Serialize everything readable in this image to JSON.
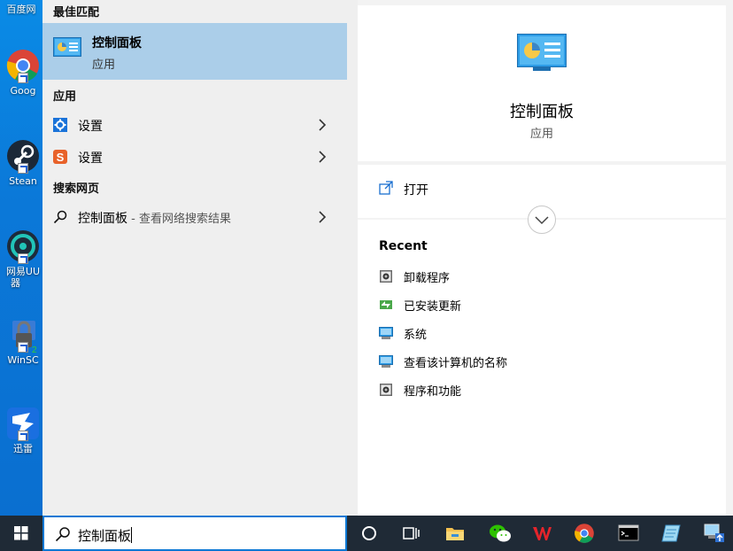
{
  "desktop": {
    "icons": [
      {
        "label": "百度网",
        "icon": "baidu-netdisk-icon"
      },
      {
        "label": "Goog",
        "icon": "chrome-icon"
      },
      {
        "label": "Stean",
        "icon": "steam-icon"
      },
      {
        "label": "网易UU",
        "label2": "器",
        "icon": "netease-uu-icon"
      },
      {
        "label": "WinSC",
        "icon": "winscp-icon"
      },
      {
        "label": "迅雷",
        "icon": "xunlei-icon"
      }
    ]
  },
  "results": {
    "best_match_title": "最佳匹配",
    "best_match": {
      "name": "控制面板",
      "kind": "应用",
      "icon": "control-panel-icon"
    },
    "apps_title": "应用",
    "apps": [
      {
        "label": "设置",
        "icon": "settings-gear-icon"
      },
      {
        "label": "设置",
        "icon": "sogou-settings-icon"
      }
    ],
    "web_title": "搜索网页",
    "web": {
      "query": "控制面板",
      "suffix": " - 查看网络搜索结果",
      "icon": "search-icon"
    }
  },
  "detail": {
    "name": "控制面板",
    "kind": "应用",
    "open_label": "打开",
    "recent_title": "Recent",
    "recent": [
      {
        "label": "卸载程序",
        "icon": "programs-icon"
      },
      {
        "label": "已安装更新",
        "icon": "updates-icon"
      },
      {
        "label": "系统",
        "icon": "system-icon"
      },
      {
        "label": "查看该计算机的名称",
        "icon": "system-icon"
      },
      {
        "label": "程序和功能",
        "icon": "programs-icon"
      }
    ]
  },
  "taskbar": {
    "search_value": "控制面板",
    "apps": [
      "cortana-icon",
      "task-view-icon",
      "file-explorer-icon",
      "wechat-icon",
      "wps-icon",
      "chrome-icon",
      "terminal-icon",
      "notepad-icon",
      "network-pc-icon"
    ]
  },
  "colors": {
    "accent": "#0a78d4",
    "best_match_bg": "#abcee9",
    "taskbar_bg": "#1f2a36"
  }
}
